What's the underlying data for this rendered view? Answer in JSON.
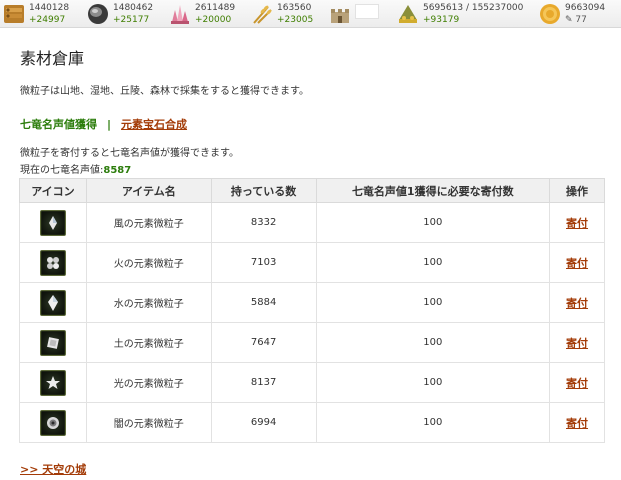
{
  "resources": [
    {
      "icon": "lumber-icon",
      "amount": "1440128",
      "gain": "+24997"
    },
    {
      "icon": "stone-icon",
      "amount": "1480462",
      "gain": "+25177"
    },
    {
      "icon": "crystal-icon",
      "amount": "2611489",
      "gain": "+20000"
    },
    {
      "icon": "wheat-icon",
      "amount": "163560",
      "gain": "+23005"
    },
    {
      "icon": "fortress-icon",
      "amount": "",
      "gain": ""
    },
    {
      "icon": "gold-pile-icon",
      "amount": "5695613 / 155237000",
      "gain": "+93179"
    },
    {
      "icon": "coin-icon",
      "amount": "9663094",
      "gain": "77"
    }
  ],
  "page": {
    "title": "素材倉庫",
    "description": "微粒子は山地、湿地、丘陵、森林で採集をすると獲得できます。"
  },
  "tabs": {
    "current": "七竜名声値獲得",
    "separator": "|",
    "other": "元素宝石合成"
  },
  "info": {
    "line1": "微粒子を寄付すると七竜名声値が獲得できます。",
    "fame_label": "現在の七竜名声値:",
    "fame_value": "8587"
  },
  "table": {
    "headers": [
      "アイコン",
      "アイテム名",
      "持っている数",
      "七竜名声値1獲得に必要な寄付数",
      "操作"
    ],
    "rows": [
      {
        "icon": "wind-particle-icon",
        "name": "風の元素微粒子",
        "owned": "8332",
        "required": "100",
        "action": "寄付"
      },
      {
        "icon": "fire-particle-icon",
        "name": "火の元素微粒子",
        "owned": "7103",
        "required": "100",
        "action": "寄付"
      },
      {
        "icon": "water-particle-icon",
        "name": "水の元素微粒子",
        "owned": "5884",
        "required": "100",
        "action": "寄付"
      },
      {
        "icon": "earth-particle-icon",
        "name": "土の元素微粒子",
        "owned": "7647",
        "required": "100",
        "action": "寄付"
      },
      {
        "icon": "light-particle-icon",
        "name": "光の元素微粒子",
        "owned": "8137",
        "required": "100",
        "action": "寄付"
      },
      {
        "icon": "dark-particle-icon",
        "name": "闇の元素微粒子",
        "owned": "6994",
        "required": "100",
        "action": "寄付"
      }
    ]
  },
  "footer": {
    "back_link": ">> 天空の城"
  }
}
